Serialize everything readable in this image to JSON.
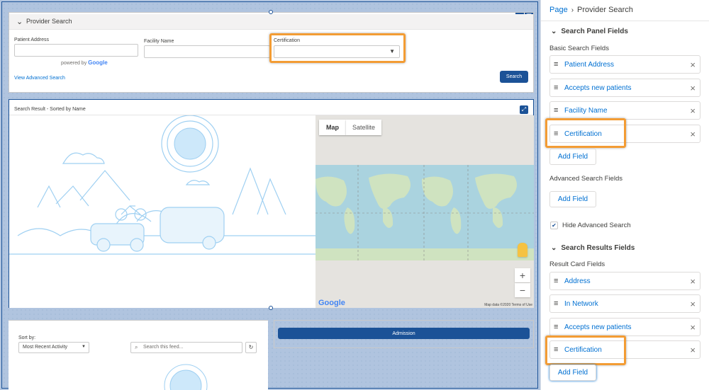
{
  "canvas": {
    "search_card": {
      "title": "Provider Search",
      "fields": [
        {
          "label": "Patient Address",
          "value": ""
        },
        {
          "label": "Facility Name",
          "value": ""
        },
        {
          "label": "Certification",
          "value": ""
        }
      ],
      "powered_by": "powered by",
      "powered_brand": "Google",
      "advanced_link": "View Advanced Search",
      "search_button": "Search"
    },
    "result_card": {
      "title": "Search Result - Sorted by Name",
      "map_tabs": [
        "Map",
        "Satellite"
      ],
      "zoom_in": "+",
      "zoom_out": "−",
      "map_data": "Map data ©2020",
      "terms": "Terms of Use",
      "google": "Google"
    },
    "feed_card": {
      "sort_label": "Sort by:",
      "sort_value": "Most Recent Activity",
      "search_placeholder": "Search this feed..."
    },
    "admission_button": "Admission"
  },
  "panel": {
    "breadcrumb": {
      "page": "Page",
      "current": "Provider Search"
    },
    "search_panel_section": "Search Panel Fields",
    "basic_label": "Basic Search Fields",
    "basic_fields": [
      "Patient Address",
      "Accepts new patients",
      "Facility Name",
      "Certification"
    ],
    "add_field": "Add Field",
    "advanced_label": "Advanced Search Fields",
    "hide_advanced": {
      "label": "Hide Advanced Search",
      "checked": true
    },
    "results_section": "Search Results Fields",
    "result_card_label": "Result Card Fields",
    "result_fields": [
      "Address",
      "In Network",
      "Accepts new patients",
      "Certification"
    ]
  },
  "colors": {
    "accent": "#1b5297",
    "link": "#0070d2",
    "highlight": "#f39c34",
    "canvas_bg": "#b0c4df"
  }
}
